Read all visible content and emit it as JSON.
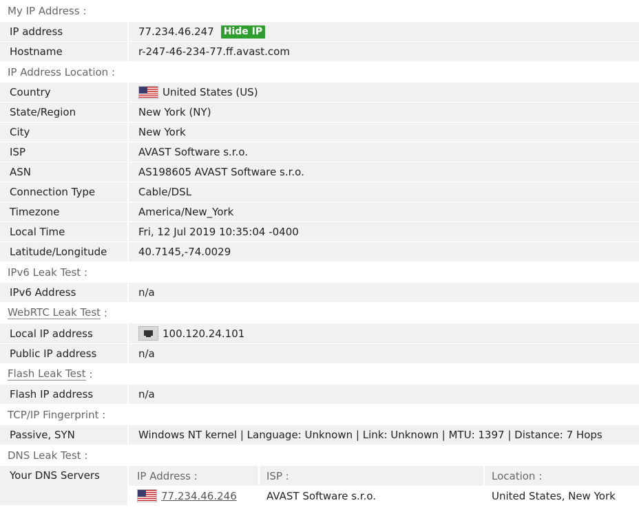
{
  "sections": {
    "my_ip": "My IP Address",
    "location": "IP Address Location",
    "ipv6": "IPv6 Leak Test",
    "webrtc": "WebRTC Leak Test",
    "flash": "Flash Leak Test",
    "tcpip": "TCP/IP Fingerprint",
    "dns": "DNS Leak Test"
  },
  "colon": ":",
  "my_ip": {
    "ip_label": "IP address",
    "ip_value": "77.234.46.247",
    "hide_ip_button": "Hide IP",
    "hostname_label": "Hostname",
    "hostname_value": "r-247-46-234-77.ff.avast.com"
  },
  "location": [
    {
      "label": "Country",
      "value": "United States (US)"
    },
    {
      "label": "State/Region",
      "value": "New York (NY)"
    },
    {
      "label": "City",
      "value": "New York"
    },
    {
      "label": "ISP",
      "value": "AVAST Software s.r.o."
    },
    {
      "label": "ASN",
      "value": "AS198605 AVAST Software s.r.o."
    },
    {
      "label": "Connection Type",
      "value": "Cable/DSL"
    },
    {
      "label": "Timezone",
      "value": "America/New_York"
    },
    {
      "label": "Local Time",
      "value": "Fri, 12 Jul 2019 10:35:04 -0400"
    },
    {
      "label": "Latitude/Longitude",
      "value": "40.7145,-74.0029"
    }
  ],
  "ipv6": {
    "label": "IPv6 Address",
    "value": "n/a"
  },
  "webrtc": {
    "local_label": "Local IP address",
    "local_value": "100.120.24.101",
    "public_label": "Public IP address",
    "public_value": "n/a"
  },
  "flash": {
    "label": "Flash IP address",
    "value": "n/a"
  },
  "tcpip": {
    "label": "Passive, SYN",
    "value": "Windows NT kernel | Language: Unknown | Link: Unknown | MTU: 1397 | Distance: 7 Hops"
  },
  "dns": {
    "label": "Your DNS Servers",
    "headers": {
      "ip": "IP Address :",
      "isp": "ISP :",
      "location": "Location :"
    },
    "rows": [
      {
        "ip": "77.234.46.246",
        "isp": "AVAST Software s.r.o.",
        "location": "United States, New York"
      }
    ]
  },
  "icons": {
    "flag": "us-flag-icon",
    "network": "network-adapter-icon"
  },
  "colors": {
    "hide_ip": "#2e9e2e",
    "row_gray": "#f1f1f1"
  }
}
